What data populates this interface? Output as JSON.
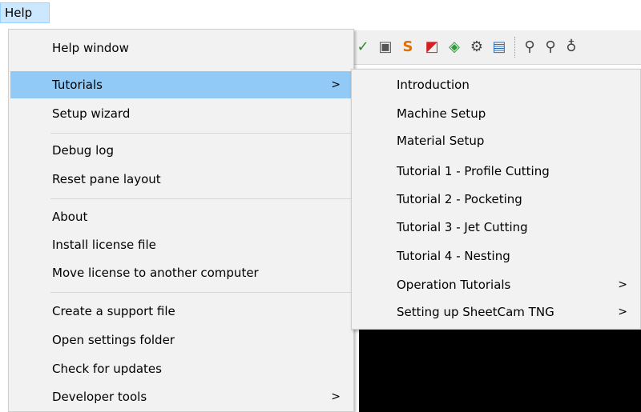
{
  "menubar": {
    "help_label": "Help"
  },
  "toolbar": {
    "icons": [
      "tick-icon",
      "layout-icon",
      "start-point-icon",
      "profile-icon",
      "layers-icon",
      "nest-icon",
      "window-icon",
      "zoom-in-icon",
      "zoom-out-icon",
      "zoom-fit-icon"
    ]
  },
  "help_menu": {
    "items": [
      {
        "label": "Help window"
      },
      {
        "label": "Tutorials",
        "arrow": ">",
        "highlighted": true
      },
      {
        "label": "Setup wizard"
      },
      {
        "label": "Debug log"
      },
      {
        "label": "Reset pane layout"
      },
      {
        "label": "About"
      },
      {
        "label": "Install license file"
      },
      {
        "label": "Move license to another computer"
      },
      {
        "label": "Create a support file"
      },
      {
        "label": "Open settings folder"
      },
      {
        "label": "Check for updates"
      },
      {
        "label": "Developer tools",
        "arrow": ">"
      }
    ]
  },
  "tutorials_submenu": {
    "items": [
      {
        "label": "Introduction"
      },
      {
        "label": "Machine Setup"
      },
      {
        "label": "Material Setup"
      },
      {
        "label": "Tutorial 1 - Profile Cutting"
      },
      {
        "label": "Tutorial 2 - Pocketing"
      },
      {
        "label": "Tutorial 3 - Jet Cutting"
      },
      {
        "label": "Tutorial 4 - Nesting"
      },
      {
        "label": "Operation Tutorials",
        "arrow": ">"
      },
      {
        "label": "Setting up SheetCam TNG",
        "arrow": ">"
      }
    ]
  }
}
